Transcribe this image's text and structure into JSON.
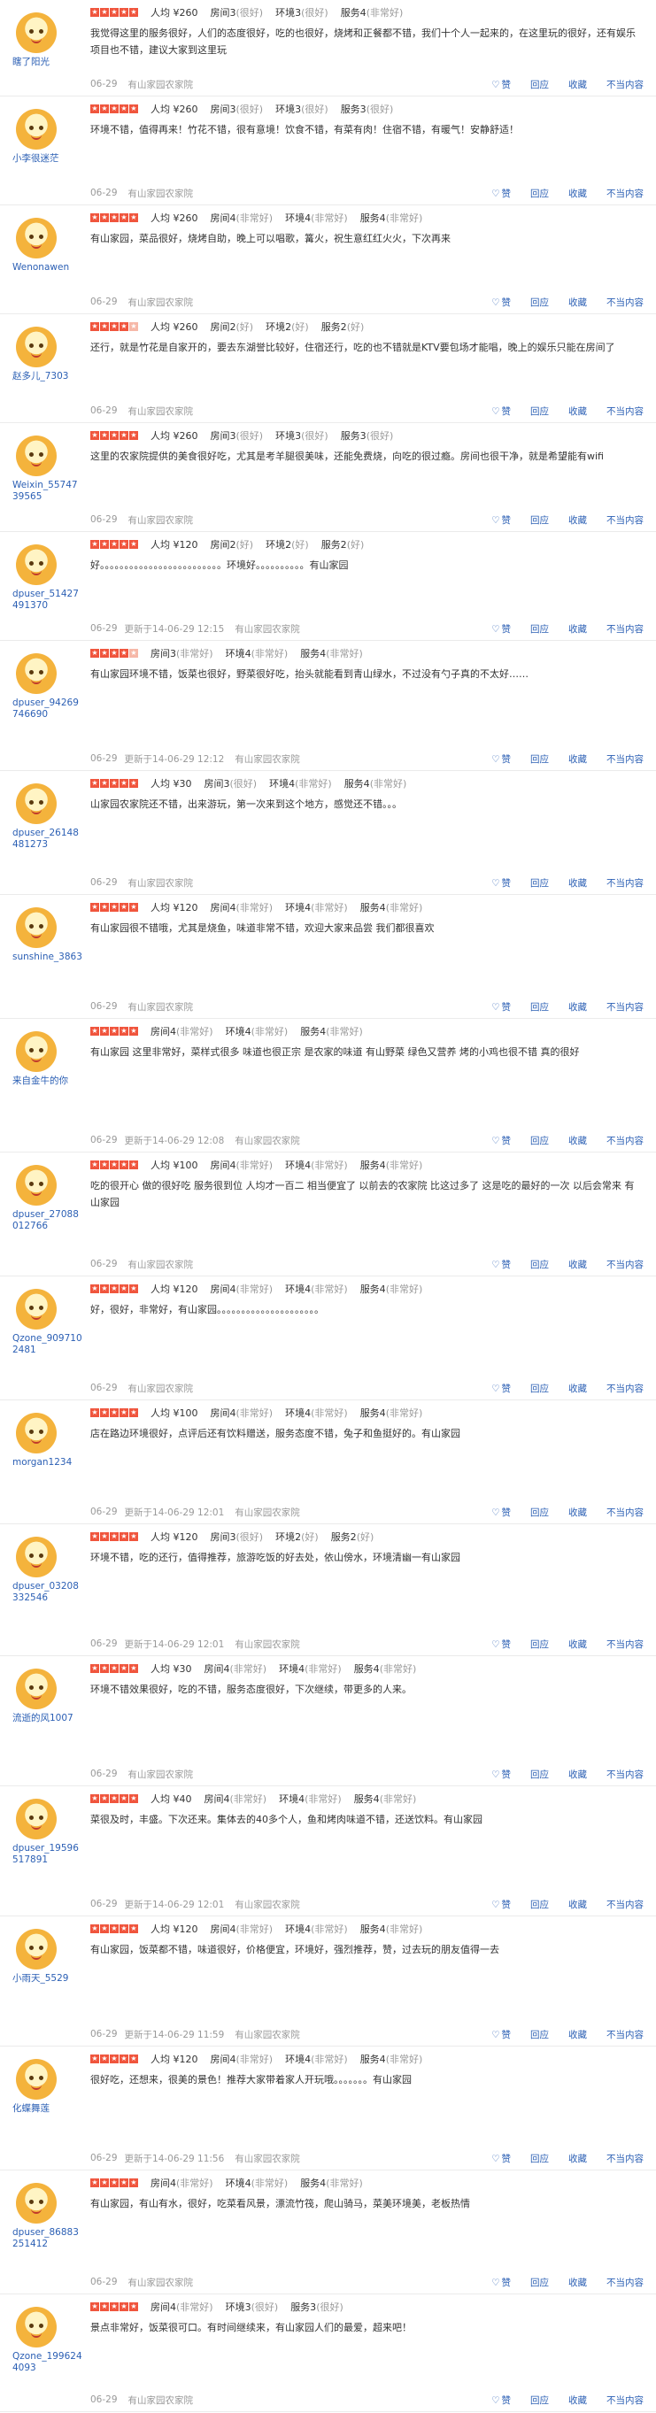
{
  "actions": {
    "like": "赞",
    "reply": "回应",
    "fav": "收藏",
    "report": "不当内容",
    "heart_icon": "♡",
    "star_glyph": "★"
  },
  "colors": {
    "star_on": "#f0553d",
    "star_off": "#f6b8a8",
    "link": "#2b5fb4"
  },
  "reviews": [
    {
      "user": "瞎了阳光",
      "stars": 5,
      "price": "人均 ¥260",
      "ratings": [
        {
          "k": "房间3",
          "q": "(很好)"
        },
        {
          "k": "环境3",
          "q": "(很好)"
        },
        {
          "k": "服务4",
          "q": "(非常好)"
        }
      ],
      "text": "我觉得这里的服务很好，人们的态度很好，吃的也很好，烧烤和正餐都不错，我们十个人一起来的，在这里玩的很好，还有娱乐项目也不错，建议大家到这里玩",
      "date": "06-29",
      "edit": "",
      "shop": "有山家园农家院"
    },
    {
      "user": "小李很迷茫",
      "stars": 5,
      "price": "人均 ¥260",
      "ratings": [
        {
          "k": "房间3",
          "q": "(很好)"
        },
        {
          "k": "环境3",
          "q": "(很好)"
        },
        {
          "k": "服务3",
          "q": "(很好)"
        }
      ],
      "text": "环境不错，值得再来！竹花不错，很有意境！饮食不错，有菜有肉！住宿不错，有暖气！安静舒适！",
      "date": "06-29",
      "edit": "",
      "shop": "有山家园农家院"
    },
    {
      "user": "Wenonawen",
      "stars": 5,
      "price": "人均 ¥260",
      "ratings": [
        {
          "k": "房间4",
          "q": "(非常好)"
        },
        {
          "k": "环境4",
          "q": "(非常好)"
        },
        {
          "k": "服务4",
          "q": "(非常好)"
        }
      ],
      "text": "有山家园，菜品很好，烧烤自助，晚上可以唱歌，篝火，祝生意红红火火，下次再来",
      "date": "06-29",
      "edit": "",
      "shop": "有山家园农家院"
    },
    {
      "user": "赵多儿_7303",
      "stars": 4,
      "price": "人均 ¥260",
      "ratings": [
        {
          "k": "房间2",
          "q": "(好)"
        },
        {
          "k": "环境2",
          "q": "(好)"
        },
        {
          "k": "服务2",
          "q": "(好)"
        }
      ],
      "text": "还行，就是竹花是自家开的，要去东湖誉比较好，住宿还行，吃的也不错就是KTV要包场才能唱，晚上的娱乐只能在房间了",
      "date": "06-29",
      "edit": "",
      "shop": "有山家园农家院"
    },
    {
      "user": "Weixin_5574739565",
      "stars": 5,
      "price": "人均 ¥260",
      "ratings": [
        {
          "k": "房间3",
          "q": "(很好)"
        },
        {
          "k": "环境3",
          "q": "(很好)"
        },
        {
          "k": "服务3",
          "q": "(很好)"
        }
      ],
      "text": "这里的农家院提供的美食很好吃，尤其是考羊腿很美味，还能免费烧，向吃的很过瘾。房间也很干净，就是希望能有wifi",
      "date": "06-29",
      "edit": "",
      "shop": "有山家园农家院"
    },
    {
      "user": "dpuser_51427491370",
      "stars": 5,
      "price": "人均 ¥120",
      "ratings": [
        {
          "k": "房间2",
          "q": "(好)"
        },
        {
          "k": "环境2",
          "q": "(好)"
        },
        {
          "k": "服务2",
          "q": "(好)"
        }
      ],
      "text": "好。。。。。。。。。。。。。。。。。。。。。。。。。环境好。。。。。。。。。。有山家园",
      "date": "06-29",
      "edit": "更新于14-06-29 12:15",
      "shop": "有山家园农家院"
    },
    {
      "user": "dpuser_94269746690",
      "stars": 4,
      "price": "",
      "ratings": [
        {
          "k": "房间3",
          "q": "(非常好)"
        },
        {
          "k": "环境4",
          "q": "(非常好)"
        },
        {
          "k": "服务4",
          "q": "(非常好)"
        }
      ],
      "text": "有山家园环境不错，饭菜也很好，野菜很好吃，抬头就能看到青山绿水，不过没有勺子真的不太好……",
      "date": "06-29",
      "edit": "更新于14-06-29 12:12",
      "shop": "有山家园农家院"
    },
    {
      "user": "dpuser_26148481273",
      "stars": 5,
      "price": "人均 ¥30",
      "ratings": [
        {
          "k": "房间3",
          "q": "(很好)"
        },
        {
          "k": "环境4",
          "q": "(非常好)"
        },
        {
          "k": "服务4",
          "q": "(非常好)"
        }
      ],
      "text": "山家园农家院还不错，出来游玩，第一次来到这个地方，感觉还不错。。。",
      "date": "06-29",
      "edit": "",
      "shop": "有山家园农家院"
    },
    {
      "user": "sunshine_3863",
      "stars": 5,
      "price": "人均 ¥120",
      "ratings": [
        {
          "k": "房间4",
          "q": "(非常好)"
        },
        {
          "k": "环境4",
          "q": "(非常好)"
        },
        {
          "k": "服务4",
          "q": "(非常好)"
        }
      ],
      "text": "有山家园很不错哦，尤其是烧鱼，味道非常不错，欢迎大家来品尝 我们都很喜欢",
      "date": "06-29",
      "edit": "",
      "shop": "有山家园农家院"
    },
    {
      "user": "来自金牛的你",
      "stars": 5,
      "price": "",
      "ratings": [
        {
          "k": "房间4",
          "q": "(非常好)"
        },
        {
          "k": "环境4",
          "q": "(非常好)"
        },
        {
          "k": "服务4",
          "q": "(非常好)"
        }
      ],
      "text": "有山家园 这里非常好，菜样式很多 味道也很正宗 是农家的味道 有山野菜 绿色又营养 烤的小鸡也很不错 真的很好",
      "date": "06-29",
      "edit": "更新于14-06-29 12:08",
      "shop": "有山家园农家院"
    },
    {
      "user": "dpuser_27088012766",
      "stars": 5,
      "price": "人均 ¥100",
      "ratings": [
        {
          "k": "房间4",
          "q": "(非常好)"
        },
        {
          "k": "环境4",
          "q": "(非常好)"
        },
        {
          "k": "服务4",
          "q": "(非常好)"
        }
      ],
      "text": "吃的很开心 做的很好吃 服务很到位 人均才一百二 相当便宜了 以前去的农家院 比这过多了 这是吃的最好的一次 以后会常来 有山家园",
      "date": "06-29",
      "edit": "",
      "shop": "有山家园农家院"
    },
    {
      "user": "Qzone_9097102481",
      "stars": 5,
      "price": "人均 ¥120",
      "ratings": [
        {
          "k": "房间4",
          "q": "(非常好)"
        },
        {
          "k": "环境4",
          "q": "(非常好)"
        },
        {
          "k": "服务4",
          "q": "(非常好)"
        }
      ],
      "text": "好，很好，非常好，有山家园。。。。。。。。。。。。。。。。。。。。。",
      "date": "06-29",
      "edit": "",
      "shop": "有山家园农家院"
    },
    {
      "user": "morgan1234",
      "stars": 5,
      "price": "人均 ¥100",
      "ratings": [
        {
          "k": "房间4",
          "q": "(非常好)"
        },
        {
          "k": "环境4",
          "q": "(非常好)"
        },
        {
          "k": "服务4",
          "q": "(非常好)"
        }
      ],
      "text": "店在路边环境很好，点评后还有饮料赠送，服务态度不错，兔子和鱼挺好的。有山家园",
      "date": "06-29",
      "edit": "更新于14-06-29 12:01",
      "shop": "有山家园农家院"
    },
    {
      "user": "dpuser_03208332546",
      "stars": 5,
      "price": "人均 ¥120",
      "ratings": [
        {
          "k": "房间3",
          "q": "(很好)"
        },
        {
          "k": "环境2",
          "q": "(好)"
        },
        {
          "k": "服务2",
          "q": "(好)"
        }
      ],
      "text": "环境不错，吃的还行，值得推荐，旅游吃饭的好去处，依山傍水，环境清幽一有山家园",
      "date": "06-29",
      "edit": "更新于14-06-29 12:01",
      "shop": "有山家园农家院"
    },
    {
      "user": "流逝的风1007",
      "stars": 5,
      "price": "人均 ¥30",
      "ratings": [
        {
          "k": "房间4",
          "q": "(非常好)"
        },
        {
          "k": "环境4",
          "q": "(非常好)"
        },
        {
          "k": "服务4",
          "q": "(非常好)"
        }
      ],
      "text": "环境不错效果很好，吃的不错，服务态度很好，下次继续，带更多的人来。",
      "date": "06-29",
      "edit": "",
      "shop": "有山家园农家院"
    },
    {
      "user": "dpuser_19596517891",
      "stars": 5,
      "price": "人均 ¥40",
      "ratings": [
        {
          "k": "房间4",
          "q": "(非常好)"
        },
        {
          "k": "环境4",
          "q": "(非常好)"
        },
        {
          "k": "服务4",
          "q": "(非常好)"
        }
      ],
      "text": "菜很及时，丰盛。下次还来。集体去的40多个人，鱼和烤肉味道不错，还送饮料。有山家园",
      "date": "06-29",
      "edit": "更新于14-06-29 12:01",
      "shop": "有山家园农家院"
    },
    {
      "user": "小雨天_5529",
      "stars": 5,
      "price": "人均 ¥120",
      "ratings": [
        {
          "k": "房间4",
          "q": "(非常好)"
        },
        {
          "k": "环境4",
          "q": "(非常好)"
        },
        {
          "k": "服务4",
          "q": "(非常好)"
        }
      ],
      "text": "有山家园，饭菜都不错，味道很好，价格便宜，环境好，强烈推荐，赞，过去玩的朋友值得一去",
      "date": "06-29",
      "edit": "更新于14-06-29 11:59",
      "shop": "有山家园农家院"
    },
    {
      "user": "化蝶舞莲",
      "stars": 5,
      "price": "人均 ¥120",
      "ratings": [
        {
          "k": "房间4",
          "q": "(非常好)"
        },
        {
          "k": "环境4",
          "q": "(非常好)"
        },
        {
          "k": "服务4",
          "q": "(非常好)"
        }
      ],
      "text": "很好吃，还想来，很美的景色！推荐大家带着家人开玩哦。。。。。。。有山家园",
      "date": "06-29",
      "edit": "更新于14-06-29 11:56",
      "shop": "有山家园农家院"
    },
    {
      "user": "dpuser_86883251412",
      "stars": 5,
      "price": "",
      "ratings": [
        {
          "k": "房间4",
          "q": "(非常好)"
        },
        {
          "k": "环境4",
          "q": "(非常好)"
        },
        {
          "k": "服务4",
          "q": "(非常好)"
        }
      ],
      "text": "有山家园，有山有水，很好，吃菜看风景，漂流竹筏，爬山骑马，菜美环境美，老板热情",
      "date": "06-29",
      "edit": "",
      "shop": "有山家园农家院"
    },
    {
      "user": "Qzone_1996244093",
      "stars": 5,
      "price": "",
      "ratings": [
        {
          "k": "房间4",
          "q": "(非常好)"
        },
        {
          "k": "环境3",
          "q": "(很好)"
        },
        {
          "k": "服务3",
          "q": "(很好)"
        }
      ],
      "text": "景点非常好，饭菜很可口。有时间继续来，有山家园人们的最爱，超来吧！",
      "date": "06-29",
      "edit": "",
      "shop": "有山家园农家院"
    }
  ]
}
